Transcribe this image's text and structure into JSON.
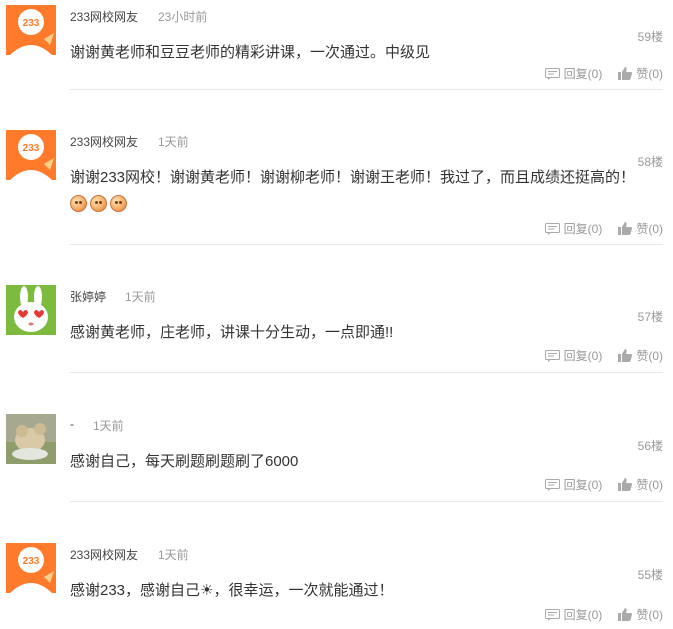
{
  "comments": [
    {
      "user": "233网校网友",
      "time": "23小时前",
      "floor": "59楼",
      "text": "谢谢黄老师和豆豆老师的精彩讲课，一次通过。中级见",
      "reply_label": "回复(0)",
      "like_label": "赞(0)",
      "avatar": "233-logo-avatar"
    },
    {
      "user": "233网校网友",
      "time": "1天前",
      "floor": "58楼",
      "text": "谢谢233网校！谢谢黄老师！谢谢柳老师！谢谢王老师！我过了，而且成绩还挺高的！",
      "emoji_count": 3,
      "reply_label": "回复(0)",
      "like_label": "赞(0)",
      "avatar": "233-logo-avatar"
    },
    {
      "user": "张婷婷",
      "time": "1天前",
      "floor": "57楼",
      "text": "感谢黄老师，庄老师，讲课十分生动，一点即通!!",
      "reply_label": "回复(0)",
      "like_label": "赞(0)",
      "avatar": "rabbit-avatar"
    },
    {
      "user": "-",
      "time": "1天前",
      "floor": "56楼",
      "text": "感谢自己，每天刷题刷题刷了6000",
      "reply_label": "回复(0)",
      "like_label": "赞(0)",
      "avatar": "photo-avatar"
    },
    {
      "user": "233网校网友",
      "time": "1天前",
      "floor": "55楼",
      "text": "感谢233，感谢自己☀，很幸运，一次就能通过！",
      "reply_label": "回复(0)",
      "like_label": "赞(0)",
      "avatar": "233-logo-avatar"
    }
  ],
  "colors": {
    "brand_orange": "#ff7a2a",
    "rabbit_green": "#7dbb3f",
    "muted_text": "#999999",
    "body_text": "#333333"
  }
}
